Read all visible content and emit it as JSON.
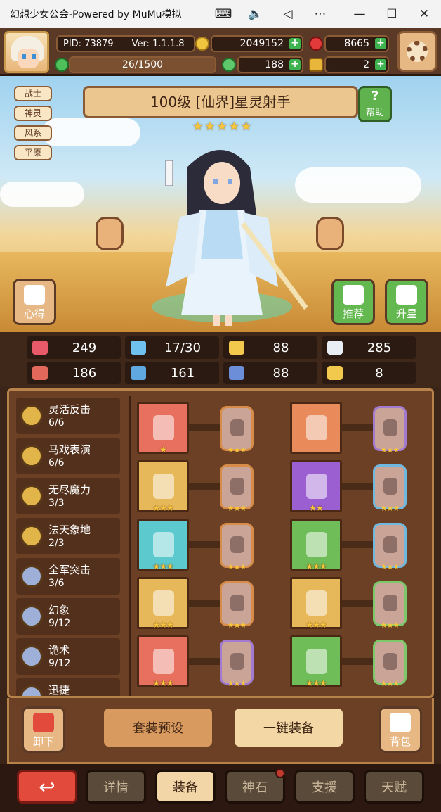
{
  "window": {
    "title": "幻想少女公会-Powered by MuMu模拟",
    "controls": [
      "keyboard-icon",
      "volume-icon",
      "back-icon",
      "more-icon",
      "minimize-icon",
      "maximize-icon",
      "close-icon"
    ]
  },
  "topbar": {
    "pid": "PID: 73879",
    "version": "Ver: 1.1.1.8",
    "gold": "2049152",
    "ruby": "8665",
    "exp": "26/1500",
    "clover": "188",
    "horn": "2"
  },
  "hero": {
    "tags": [
      "战士",
      "神灵",
      "风系",
      "平原"
    ],
    "name": "100级 [仙界]星灵射手",
    "stars": 5,
    "help_label": "帮助",
    "insight_label": "心得",
    "recommend_label": "推荐",
    "upgrade_label": "升星"
  },
  "stats": [
    {
      "icon": "heart-icon",
      "value": "249",
      "color": "#e85a6a"
    },
    {
      "icon": "water-drop-icon",
      "value": "17/30",
      "color": "#6fc2f0"
    },
    {
      "icon": "shield-icon",
      "value": "88",
      "color": "#f2c94c"
    },
    {
      "icon": "wing-icon",
      "value": "285",
      "color": "#e8eef4"
    },
    {
      "icon": "fist-icon",
      "value": "186",
      "color": "#e2685c"
    },
    {
      "icon": "book-icon",
      "value": "161",
      "color": "#5fa9e0"
    },
    {
      "icon": "boot-icon",
      "value": "88",
      "color": "#6c8ed8"
    },
    {
      "icon": "horseshoe-icon",
      "value": "8",
      "color": "#f2c94c"
    }
  ],
  "skills": [
    {
      "name": "灵活反击",
      "count": "6/6",
      "color": "#e2b54a"
    },
    {
      "name": "马戏表演",
      "count": "6/6",
      "color": "#e2b54a"
    },
    {
      "name": "无尽魔力",
      "count": "3/3",
      "color": "#e2b54a"
    },
    {
      "name": "法天象地",
      "count": "2/3",
      "color": "#e2b54a"
    },
    {
      "name": "全军突击",
      "count": "3/6",
      "color": "#9fb0d8"
    },
    {
      "name": "幻象",
      "count": "9/12",
      "color": "#9fb0d8"
    },
    {
      "name": "诡术",
      "count": "9/12",
      "color": "#9fb0d8"
    },
    {
      "name": "迅捷",
      "count": "",
      "color": "#9fb0d8"
    }
  ],
  "equipment": [
    {
      "item": "staff-icon",
      "bg": "#e7705e",
      "stars": "★",
      "rune_border": "#d88c4a",
      "rune_stars": "★★★"
    },
    {
      "item": "golden-crown-icon",
      "bg": "#e88a5a",
      "stars": "",
      "rune_border": "#a27bd1",
      "rune_stars": "★★★"
    },
    {
      "item": "crossed-swords-icon",
      "bg": "#e7b85a",
      "stars": "★★★",
      "rune_border": "#d88c4a",
      "rune_stars": "★★★"
    },
    {
      "item": "green-cloak-icon",
      "bg": "#9b5fd1",
      "stars": "★★",
      "rune_border": "#6fb8e0",
      "rune_stars": "★★★"
    },
    {
      "item": "necklace-icon",
      "bg": "#5cc9cf",
      "stars": "★★★",
      "rune_border": "#d88c4a",
      "rune_stars": "★★★"
    },
    {
      "item": "bandage-icon",
      "bg": "#6fbd58",
      "stars": "★★★",
      "rune_border": "#6fb8e0",
      "rune_stars": "★★★"
    },
    {
      "item": "jewel-amulet-icon",
      "bg": "#e7b85a",
      "stars": "★★★",
      "rune_border": "#d88c4a",
      "rune_stars": "★★★"
    },
    {
      "item": "dark-ring-icon",
      "bg": "#e7b85a",
      "stars": "★★★",
      "rune_border": "#7bc96a",
      "rune_stars": "★★★"
    },
    {
      "item": "bracelet-icon",
      "bg": "#e7705e",
      "stars": "★★★",
      "rune_border": "#a27bd1",
      "rune_stars": "★★★"
    },
    {
      "item": "boots-icon",
      "bg": "#6fbd58",
      "stars": "★★★",
      "rune_border": "#7bc96a",
      "rune_stars": "★★★"
    }
  ],
  "actions": {
    "unequip_label": "卸下",
    "preset_label": "套装预设",
    "auto_equip_label": "一键装备",
    "bag_label": "背包"
  },
  "tabs": [
    {
      "label": "详情",
      "active": false
    },
    {
      "label": "装备",
      "active": true
    },
    {
      "label": "神石",
      "active": false
    },
    {
      "label": "支援",
      "active": false
    },
    {
      "label": "天赋",
      "active": false
    }
  ]
}
